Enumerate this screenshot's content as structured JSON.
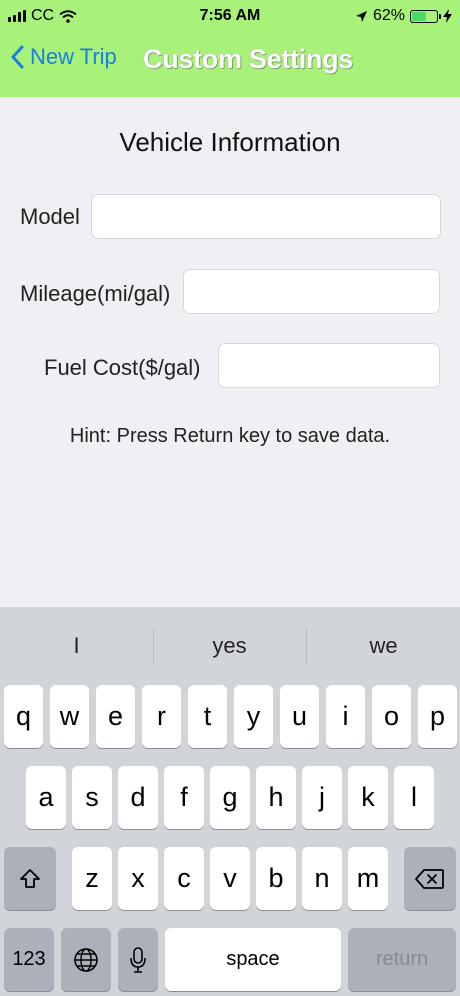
{
  "status": {
    "carrier": "CC",
    "time": "7:56 AM",
    "battery_pct": "62%",
    "battery_level": 0.62,
    "icons": [
      "signal-icon",
      "wifi-icon",
      "location-arrow-icon",
      "battery-icon",
      "charging-bolt-icon"
    ]
  },
  "nav": {
    "back_label": "New Trip",
    "title": "Custom Settings",
    "bar_color": "#a9f27a"
  },
  "form": {
    "title": "Vehicle Information",
    "model_label": "Model",
    "mileage_label": "Mileage(mi/gal)",
    "fuel_label": "Fuel Cost($/gal)",
    "model_value": "",
    "mileage_value": "",
    "fuel_value": "",
    "hint": "Hint: Press Return key to save data."
  },
  "keyboard": {
    "suggestions": [
      "I",
      "yes",
      "we"
    ],
    "row1": [
      "q",
      "w",
      "e",
      "r",
      "t",
      "y",
      "u",
      "i",
      "o",
      "p"
    ],
    "row2": [
      "a",
      "s",
      "d",
      "f",
      "g",
      "h",
      "j",
      "k",
      "l"
    ],
    "row3": [
      "z",
      "x",
      "c",
      "v",
      "b",
      "n",
      "m"
    ],
    "numbers_label": "123",
    "space_label": "space",
    "return_label": "return"
  }
}
